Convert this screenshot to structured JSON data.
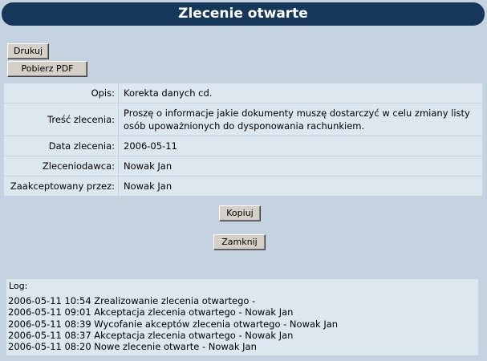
{
  "header": {
    "title": "Zlecenie otwarte"
  },
  "toolbar": {
    "print_label": "Drukuj",
    "pdf_label": "Pobierz PDF"
  },
  "details": [
    {
      "label": "Opis:",
      "value": "Korekta danych cd."
    },
    {
      "label": "Treść zlecenia:",
      "value": "Proszę o informacje jakie dokumenty muszę dostarczyć w celu zmiany listy osób upoważnionych do dysponowania rachunkiem."
    },
    {
      "label": "Data zlecenia:",
      "value": "2006-05-11"
    },
    {
      "label": "Zleceniodawca:",
      "value": "Nowak Jan"
    },
    {
      "label": "Zaakceptowany przez:",
      "value": "Nowak Jan"
    }
  ],
  "actions": {
    "copy_label": "Kopiuj",
    "close_label": "Zamknij"
  },
  "log": {
    "label": "Log:",
    "entries": [
      "2006-05-11 10:54 Zrealizowanie zlecenia otwartego -",
      "2006-05-11 09:01 Akceptacja zlecenia otwartego - Nowak Jan",
      "2006-05-11 08:39 Wycofanie akceptów zlecenia otwartego - Nowak Jan",
      "2006-05-11 08:37 Akceptacja zlecenia otwartego - Nowak Jan",
      "2006-05-11 08:20 Nowe zlecenie otwarte - Nowak Jan"
    ]
  },
  "colors": {
    "background": "#c4d3df",
    "title_bar": "#14375a",
    "cell": "#dde7ef"
  }
}
